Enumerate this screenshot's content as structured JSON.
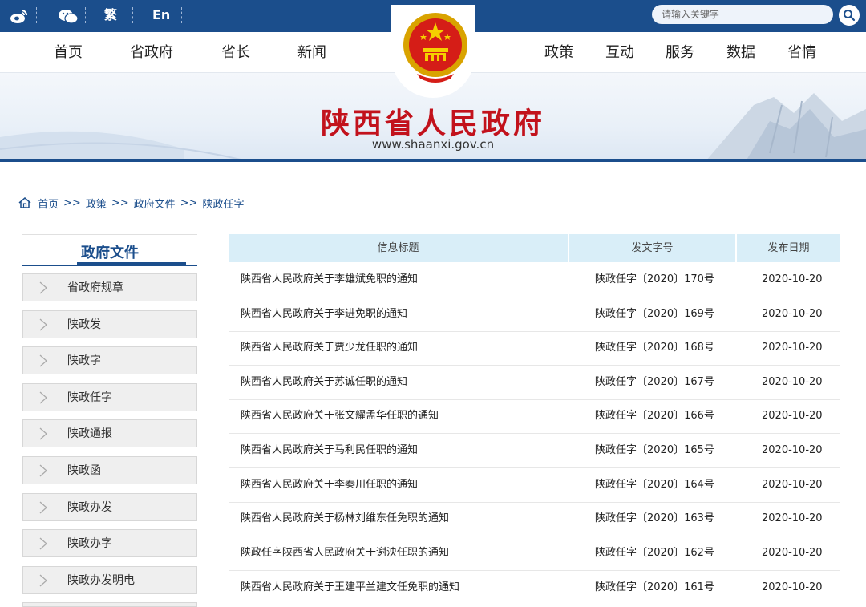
{
  "topbar": {
    "weibo_icon": "weibo-icon",
    "wechat_icon": "wechat-icon",
    "traditional_label": "繁",
    "english_label": "En",
    "search_placeholder": "请输入关键字",
    "search_icon": "search-icon"
  },
  "nav": {
    "items": [
      "首页",
      "省政府",
      "省长",
      "新闻",
      "政策",
      "互动",
      "服务",
      "数据",
      "省情"
    ]
  },
  "banner": {
    "title": "陕西省人民政府",
    "url": "www.shaanxi.gov.cn",
    "emblem": "national-emblem"
  },
  "breadcrumb": {
    "home_icon": "home-icon",
    "items": [
      "首页",
      "政策",
      "政府文件",
      "陕政任字"
    ],
    "separator": ">>"
  },
  "sidebar": {
    "title": "政府文件",
    "items": [
      "省政府规章",
      "陕政发",
      "陕政字",
      "陕政任字",
      "陕政通报",
      "陕政函",
      "陕政办发",
      "陕政办字",
      "陕政办发明电"
    ]
  },
  "table": {
    "headers": [
      "信息标题",
      "发文字号",
      "发布日期"
    ],
    "rows": [
      {
        "title": "陕西省人民政府关于李雄斌免职的通知",
        "number": "陕政任字〔2020〕170号",
        "date": "2020-10-20"
      },
      {
        "title": "陕西省人民政府关于李进免职的通知",
        "number": "陕政任字〔2020〕169号",
        "date": "2020-10-20"
      },
      {
        "title": "陕西省人民政府关于贾少龙任职的通知",
        "number": "陕政任字〔2020〕168号",
        "date": "2020-10-20"
      },
      {
        "title": "陕西省人民政府关于苏诚任职的通知",
        "number": "陕政任字〔2020〕167号",
        "date": "2020-10-20"
      },
      {
        "title": "陕西省人民政府关于张文耀孟华任职的通知",
        "number": "陕政任字〔2020〕166号",
        "date": "2020-10-20"
      },
      {
        "title": "陕西省人民政府关于马利民任职的通知",
        "number": "陕政任字〔2020〕165号",
        "date": "2020-10-20"
      },
      {
        "title": "陕西省人民政府关于李秦川任职的通知",
        "number": "陕政任字〔2020〕164号",
        "date": "2020-10-20"
      },
      {
        "title": "陕西省人民政府关于杨林刘维东任免职的通知",
        "number": "陕政任字〔2020〕163号",
        "date": "2020-10-20"
      },
      {
        "title": "陕政任字陕西省人民政府关于谢泱任职的通知",
        "number": "陕政任字〔2020〕162号",
        "date": "2020-10-20"
      },
      {
        "title": "陕西省人民政府关于王建平兰建文任免职的通知",
        "number": "陕政任字〔2020〕161号",
        "date": "2020-10-20"
      }
    ]
  },
  "colors": {
    "brand_blue": "#1b4e8c",
    "title_red": "#c2121c",
    "header_bg": "#d9eef8"
  }
}
